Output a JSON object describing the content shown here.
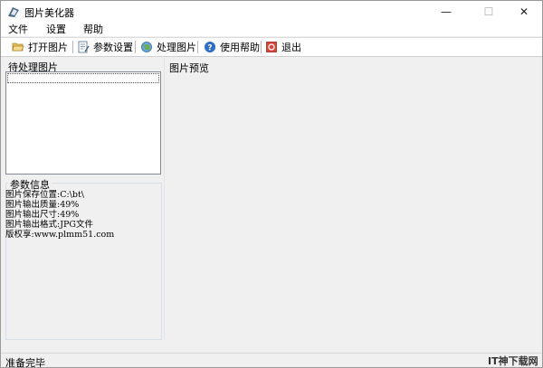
{
  "window": {
    "title": "图片美化器",
    "minimize": "—",
    "maximize": "☐",
    "close": "✕"
  },
  "menu": [
    "文件",
    "设置",
    "帮助"
  ],
  "toolbar": {
    "open": "打开图片",
    "settings": "参数设置",
    "process": "处理图片",
    "help": "使用帮助",
    "exit": "退出"
  },
  "pending": {
    "title": "待处理图片"
  },
  "params": {
    "title": "参数信息",
    "lines": [
      "图片保存位置:C:\\bt\\",
      "图片输出质量:49%",
      "图片输出尺寸:49%",
      "图片输出格式:JPG文件",
      "版权享:www.plmm51.com"
    ]
  },
  "preview": {
    "title": "图片预览"
  },
  "status": {
    "text": "准备完毕"
  },
  "watermark": "IT神下载网",
  "colors": {
    "toolbar_bg": "#ffffff",
    "panel_bg": "#f0f0f0",
    "list_border": "#828790"
  }
}
